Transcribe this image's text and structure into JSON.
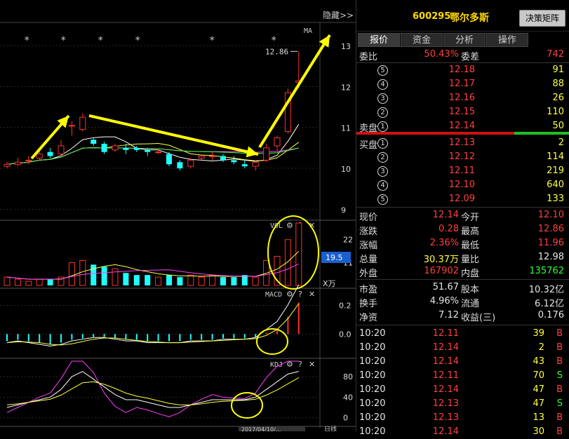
{
  "chart": {
    "hide_label": "隐藏>>",
    "ma_label": "MA",
    "high_label": "12.86",
    "vol_label": "VOL",
    "vol_current": "19.5",
    "vol_unit": "X万",
    "macd_label": "MACD",
    "kdj_label": "KDJ",
    "price_ticks": [
      "13",
      "12",
      "11",
      "10",
      "9"
    ],
    "vol_ticks": [
      "22",
      "11"
    ],
    "macd_ticks": [
      "0.2",
      "0.0"
    ],
    "kdj_ticks": [
      "80",
      "40",
      "0"
    ],
    "bottom_label": "2017/04/10/...",
    "bottom_right_label": "日线"
  },
  "chart_data": {
    "type": "candlestick",
    "price_ylim": [
      8.8,
      13.5
    ],
    "candles": [
      {
        "o": 10.05,
        "c": 10.1,
        "h": 10.15,
        "l": 10.0
      },
      {
        "o": 10.1,
        "c": 10.15,
        "h": 10.25,
        "l": 10.05
      },
      {
        "o": 10.2,
        "c": 10.2,
        "h": 10.3,
        "l": 10.1
      },
      {
        "o": 10.25,
        "c": 10.35,
        "h": 10.45,
        "l": 10.2
      },
      {
        "o": 10.4,
        "c": 10.3,
        "h": 10.5,
        "l": 10.25
      },
      {
        "o": 10.35,
        "c": 10.55,
        "h": 10.7,
        "l": 10.3
      },
      {
        "o": 11.05,
        "c": 11.05,
        "h": 11.15,
        "l": 10.8
      },
      {
        "o": 10.95,
        "c": 11.25,
        "h": 11.35,
        "l": 10.9
      },
      {
        "o": 10.7,
        "c": 10.6,
        "h": 10.75,
        "l": 10.55
      },
      {
        "o": 10.6,
        "c": 10.4,
        "h": 10.65,
        "l": 10.35
      },
      {
        "o": 10.45,
        "c": 10.55,
        "h": 10.6,
        "l": 10.4
      },
      {
        "o": 10.5,
        "c": 10.45,
        "h": 10.6,
        "l": 10.35
      },
      {
        "o": 10.5,
        "c": 10.45,
        "h": 10.55,
        "l": 10.4
      },
      {
        "o": 10.45,
        "c": 10.4,
        "h": 10.5,
        "l": 10.3
      },
      {
        "o": 10.4,
        "c": 10.4,
        "h": 10.45,
        "l": 10.35
      },
      {
        "o": 10.35,
        "c": 10.1,
        "h": 10.4,
        "l": 10.05
      },
      {
        "o": 10.15,
        "c": 10.0,
        "h": 10.2,
        "l": 9.95
      },
      {
        "o": 10.05,
        "c": 10.2,
        "h": 10.25,
        "l": 10.0
      },
      {
        "o": 10.25,
        "c": 10.3,
        "h": 10.35,
        "l": 10.2
      },
      {
        "o": 10.3,
        "c": 10.3,
        "h": 10.4,
        "l": 10.2
      },
      {
        "o": 10.3,
        "c": 10.2,
        "h": 10.35,
        "l": 10.15
      },
      {
        "o": 10.2,
        "c": 10.15,
        "h": 10.3,
        "l": 10.1
      },
      {
        "o": 10.1,
        "c": 10.05,
        "h": 10.2,
        "l": 10.0
      },
      {
        "o": 10.05,
        "c": 10.15,
        "h": 10.2,
        "l": 9.95
      },
      {
        "o": 10.2,
        "c": 10.5,
        "h": 10.6,
        "l": 10.15
      },
      {
        "o": 10.55,
        "c": 10.75,
        "h": 10.8,
        "l": 10.4
      },
      {
        "o": 10.9,
        "c": 11.85,
        "h": 11.95,
        "l": 10.85
      },
      {
        "o": 12.1,
        "c": 12.14,
        "h": 12.86,
        "l": 11.96
      }
    ],
    "volumes": [
      4,
      3,
      2,
      3,
      3,
      4,
      11,
      12,
      10,
      9,
      8,
      6,
      5,
      5,
      4,
      5,
      4,
      5,
      4,
      5,
      4,
      4,
      5,
      4,
      12,
      14,
      22,
      30
    ],
    "macd_hist": [
      -0.05,
      -0.04,
      -0.05,
      -0.06,
      -0.07,
      -0.06,
      -0.04,
      -0.03,
      -0.02,
      -0.02,
      -0.03,
      -0.04,
      -0.04,
      -0.05,
      -0.05,
      -0.05,
      -0.05,
      -0.04,
      -0.04,
      -0.04,
      -0.03,
      -0.03,
      -0.03,
      -0.02,
      0.01,
      0.04,
      0.12,
      0.22
    ],
    "kdj_k": [
      20,
      25,
      30,
      35,
      40,
      55,
      80,
      90,
      75,
      60,
      45,
      35,
      35,
      30,
      25,
      20,
      20,
      25,
      30,
      35,
      35,
      35,
      35,
      40,
      55,
      70,
      85,
      90
    ],
    "kdj_d": [
      25,
      27,
      30,
      33,
      36,
      44,
      56,
      68,
      70,
      65,
      57,
      48,
      42,
      38,
      33,
      28,
      25,
      25,
      27,
      30,
      32,
      33,
      34,
      36,
      44,
      54,
      66,
      78
    ],
    "kdj_j": [
      10,
      20,
      30,
      40,
      48,
      76,
      120,
      130,
      88,
      48,
      22,
      10,
      20,
      15,
      8,
      2,
      10,
      25,
      36,
      45,
      40,
      38,
      37,
      48,
      78,
      100,
      120,
      110
    ]
  },
  "quote": {
    "code": "600295",
    "name": "鄂尔多斯",
    "decision_btn": "决策矩阵",
    "tabs": [
      "报价",
      "资金",
      "分析",
      "操作"
    ],
    "weibi_label": "委比",
    "weibi_value": "50.43%",
    "weicha_label": "委差",
    "weicha_value": "742",
    "sell_label": "卖盘",
    "buy_label": "买盘",
    "sell": [
      {
        "n": "⑤",
        "price": "12.18",
        "vol": "91"
      },
      {
        "n": "④",
        "price": "12.17",
        "vol": "88"
      },
      {
        "n": "③",
        "price": "12.16",
        "vol": "26"
      },
      {
        "n": "②",
        "price": "12.15",
        "vol": "110"
      },
      {
        "n": "①",
        "price": "12.14",
        "vol": "50"
      }
    ],
    "buy": [
      {
        "n": "①",
        "price": "12.13",
        "vol": "2"
      },
      {
        "n": "②",
        "price": "12.12",
        "vol": "114"
      },
      {
        "n": "③",
        "price": "12.11",
        "vol": "219"
      },
      {
        "n": "④",
        "price": "12.10",
        "vol": "640"
      },
      {
        "n": "⑤",
        "price": "12.09",
        "vol": "133"
      }
    ],
    "stats": [
      {
        "l1": "现价",
        "v1": "12.14",
        "c1": "red",
        "l2": "今开",
        "v2": "12.10",
        "c2": "red"
      },
      {
        "l1": "涨跌",
        "v1": "0.28",
        "c1": "red",
        "l2": "最高",
        "v2": "12.86",
        "c2": "red"
      },
      {
        "l1": "涨幅",
        "v1": "2.36%",
        "c1": "red",
        "l2": "最低",
        "v2": "11.96",
        "c2": "red"
      },
      {
        "l1": "总量",
        "v1": "30.37万",
        "c1": "yel",
        "l2": "量比",
        "v2": "12.98",
        "c2": "wht"
      },
      {
        "l1": "外盘",
        "v1": "167902",
        "c1": "red",
        "l2": "内盘",
        "v2": "135762",
        "c2": "grn"
      }
    ],
    "stats2": [
      {
        "l1": "市盈",
        "v1": "51.67",
        "l2": "股本",
        "v2": "10.32亿"
      },
      {
        "l1": "换手",
        "v1": "4.96%",
        "l2": "流通",
        "v2": "6.12亿"
      },
      {
        "l1": "净资",
        "v1": "7.12",
        "l2": "收益(三)",
        "v2": "0.176"
      }
    ],
    "ticks": [
      {
        "t": "10:20",
        "p": "12.11",
        "v": "39",
        "s": "B"
      },
      {
        "t": "10:20",
        "p": "12.14",
        "v": "2",
        "s": "B"
      },
      {
        "t": "10:20",
        "p": "12.14",
        "v": "43",
        "s": "B"
      },
      {
        "t": "10:20",
        "p": "12.11",
        "v": "70",
        "s": "S"
      },
      {
        "t": "10:20",
        "p": "12.14",
        "v": "47",
        "s": "B"
      },
      {
        "t": "10:20",
        "p": "12.13",
        "v": "47",
        "s": "S"
      },
      {
        "t": "10:20",
        "p": "12.13",
        "v": "13",
        "s": "B"
      },
      {
        "t": "10:20",
        "p": "12.14",
        "v": "30",
        "s": "B"
      }
    ]
  }
}
